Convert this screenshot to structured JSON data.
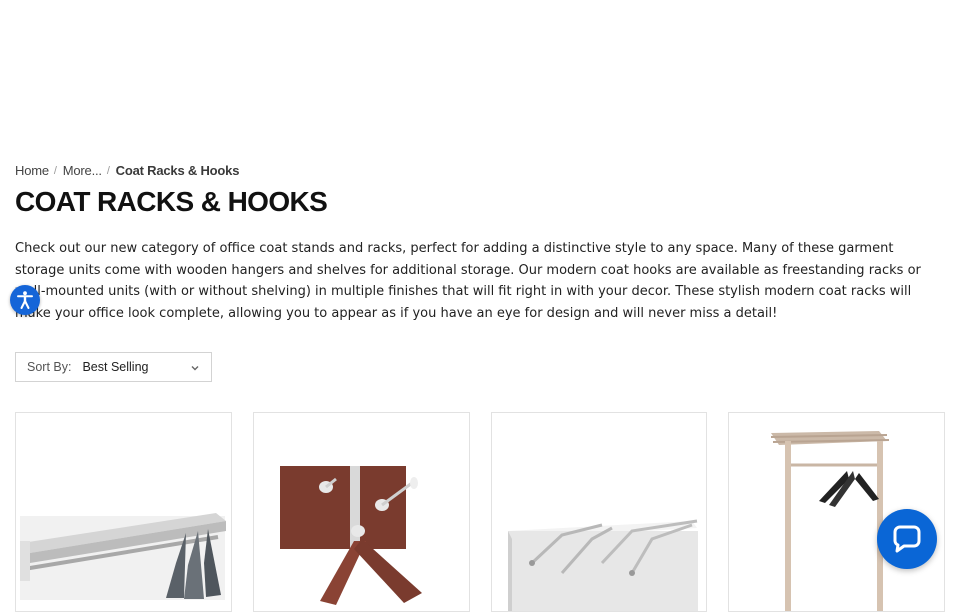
{
  "breadcrumb": {
    "home": "Home",
    "more": "More...",
    "current": "Coat Racks & Hooks",
    "separator": "/"
  },
  "page": {
    "title": "COAT RACKS & HOOKS",
    "description": "Check out our new category of office coat stands and racks, perfect for adding a distinctive style to any space. Many of these garment storage units come with wooden hangers and shelves for additional storage. Our modern coat hooks are available as freestanding racks or wall-mounted units (with or without shelving) in multiple finishes that will fit right in with your decor. These stylish modern coat racks will make your office look complete, allowing you to appear as if you have an eye for design and will never miss a detail!"
  },
  "sort": {
    "label": "Sort By:",
    "value": "Best Selling"
  },
  "products": [
    {
      "image": "wall-shelf-rack-with-hangers"
    },
    {
      "image": "wooden-wall-hook-rack"
    },
    {
      "image": "chrome-wall-hook-rack"
    },
    {
      "image": "freestanding-coat-rack"
    }
  ],
  "widgets": {
    "accessibility_icon": "accessibility-icon",
    "chat_icon": "chat-icon"
  },
  "colors": {
    "accent_blue": "#0a66d6",
    "accessibility_blue": "#1565d8"
  }
}
